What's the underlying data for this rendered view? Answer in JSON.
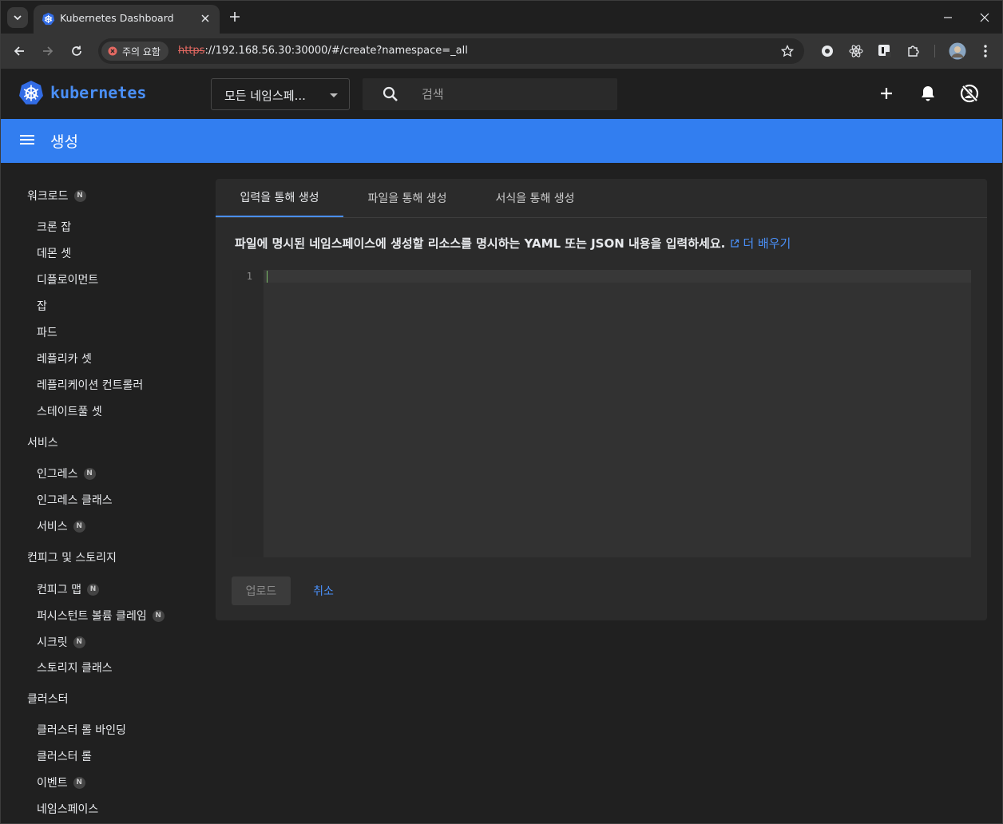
{
  "browser": {
    "tab_title": "Kubernetes Dashboard",
    "security_chip": "주의 요함",
    "url_scheme": "https",
    "url_rest": "://192.168.56.30:30000/#/create?namespace=_all"
  },
  "header": {
    "logo_text": "kubernetes",
    "namespace_value": "모든 네임스페...",
    "search_placeholder": "검색"
  },
  "page": {
    "title": "생성"
  },
  "sidebar": {
    "sections": [
      {
        "label": "워크로드",
        "badge": "N",
        "items": [
          {
            "label": "크론 잡"
          },
          {
            "label": "데몬 셋"
          },
          {
            "label": "디플로이먼트"
          },
          {
            "label": "잡"
          },
          {
            "label": "파드"
          },
          {
            "label": "레플리카 셋"
          },
          {
            "label": "레플리케이션 컨트롤러"
          },
          {
            "label": "스테이트풀 셋"
          }
        ]
      },
      {
        "label": "서비스",
        "items": [
          {
            "label": "인그레스",
            "badge": "N"
          },
          {
            "label": "인그레스 클래스"
          },
          {
            "label": "서비스",
            "badge": "N"
          }
        ]
      },
      {
        "label": "컨피그 및 스토리지",
        "items": [
          {
            "label": "컨피그 맵",
            "badge": "N"
          },
          {
            "label": "퍼시스턴트 볼륨 클레임",
            "badge": "N"
          },
          {
            "label": "시크릿",
            "badge": "N"
          },
          {
            "label": "스토리지 클래스"
          }
        ]
      },
      {
        "label": "클러스터",
        "items": [
          {
            "label": "클러스터 롤 바인딩"
          },
          {
            "label": "클러스터 롤"
          },
          {
            "label": "이벤트",
            "badge": "N"
          },
          {
            "label": "네임스페이스"
          }
        ]
      }
    ]
  },
  "main": {
    "tabs": [
      {
        "label": "입력을 통해 생성",
        "active": true
      },
      {
        "label": "파일을 통해 생성"
      },
      {
        "label": "서식을 통해 생성"
      }
    ],
    "description_bold": "파일에 명시된 네임스페이스에 생성할 리소스를 명시하는 YAML 또는 JSON 내용을 입력하세요.",
    "learn_more": "더 배우기",
    "editor_line_number": "1",
    "upload_label": "업로드",
    "cancel_label": "취소"
  },
  "colors": {
    "accent": "#327ef0",
    "link": "#4a8ff7",
    "warning": "#e46962"
  }
}
